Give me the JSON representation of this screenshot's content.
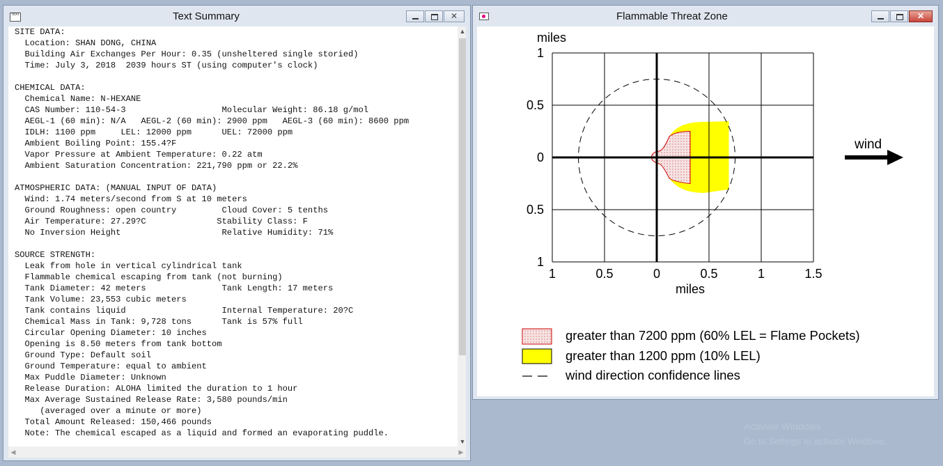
{
  "text_window": {
    "title": "Text Summary",
    "icon": "text-document-icon",
    "lines": [
      "SITE DATA:",
      "  Location: SHAN DONG, CHINA",
      "  Building Air Exchanges Per Hour: 0.35 (unsheltered single storied)",
      "  Time: July 3, 2018  2039 hours ST (using computer's clock)",
      "",
      "CHEMICAL DATA:",
      "  Chemical Name: N-HEXANE",
      "  CAS Number: 110-54-3                   Molecular Weight: 86.18 g/mol",
      "  AEGL-1 (60 min): N/A   AEGL-2 (60 min): 2900 ppm   AEGL-3 (60 min): 8600 ppm",
      "  IDLH: 1100 ppm     LEL: 12000 ppm      UEL: 72000 ppm",
      "  Ambient Boiling Point: 155.4?F",
      "  Vapor Pressure at Ambient Temperature: 0.22 atm",
      "  Ambient Saturation Concentration: 221,790 ppm or 22.2%",
      "",
      "ATMOSPHERIC DATA: (MANUAL INPUT OF DATA)",
      "  Wind: 1.74 meters/second from S at 10 meters",
      "  Ground Roughness: open country         Cloud Cover: 5 tenths",
      "  Air Temperature: 27.29?C              Stability Class: F",
      "  No Inversion Height                    Relative Humidity: 71%",
      "",
      "SOURCE STRENGTH:",
      "  Leak from hole in vertical cylindrical tank",
      "  Flammable chemical escaping from tank (not burning)",
      "  Tank Diameter: 42 meters               Tank Length: 17 meters",
      "  Tank Volume: 23,553 cubic meters",
      "  Tank contains liquid                   Internal Temperature: 20?C",
      "  Chemical Mass in Tank: 9,728 tons      Tank is 57% full",
      "  Circular Opening Diameter: 10 inches",
      "  Opening is 8.50 meters from tank bottom",
      "  Ground Type: Default soil",
      "  Ground Temperature: equal to ambient",
      "  Max Puddle Diameter: Unknown",
      "  Release Duration: ALOHA limited the duration to 1 hour",
      "  Max Average Sustained Release Rate: 3,580 pounds/min",
      "     (averaged over a minute or more)",
      "  Total Amount Released: 150,466 pounds",
      "  Note: The chemical escaped as a liquid and formed an evaporating puddle."
    ]
  },
  "chart_window": {
    "title": "Flammable Threat Zone",
    "icon": "aloha-threat-zone-icon",
    "wind_label": "wind",
    "legend": {
      "flame_pockets": "greater than 7200 ppm (60% LEL = Flame Pockets)",
      "lel10": "greater than 1200 ppm (10% LEL)",
      "confidence": "wind direction confidence lines"
    },
    "colors": {
      "flame_pockets_fill": "#f3dada",
      "flame_pockets_stroke": "#cc0000",
      "lel10_fill": "#ffff00",
      "grid": "#000000"
    }
  },
  "chart_data": {
    "type": "threat-zone-map",
    "title": "Flammable Threat Zone",
    "xlabel": "miles",
    "ylabel": "miles",
    "xlim": [
      -1,
      1.5
    ],
    "ylim": [
      -1,
      1
    ],
    "x_ticks": [
      -1,
      -0.5,
      0,
      0.5,
      1,
      1.5
    ],
    "y_ticks": [
      1,
      0.5,
      0,
      -0.5,
      -1
    ],
    "x_tick_labels": [
      "1",
      "0.5",
      "0",
      "0.5",
      "1",
      "1.5"
    ],
    "y_tick_labels": [
      "1",
      "0.5",
      "0",
      "0.5",
      "1"
    ],
    "grid": true,
    "legend_position": "bottom",
    "zones": [
      {
        "name": "greater than 7200 ppm (60% LEL = Flame Pockets)",
        "extent_x": [
          -0.05,
          0.32
        ],
        "half_width": 0.25
      },
      {
        "name": "greater than 1200 ppm (10% LEL)",
        "extent_x": [
          -0.05,
          0.69
        ],
        "half_width": 0.34
      }
    ],
    "confidence_circle_radius": 0.75,
    "wind_direction": "east"
  },
  "desktop": {
    "faded_line1": "Activate Windows",
    "faded_line2": "Go to Settings to activate Windows."
  }
}
